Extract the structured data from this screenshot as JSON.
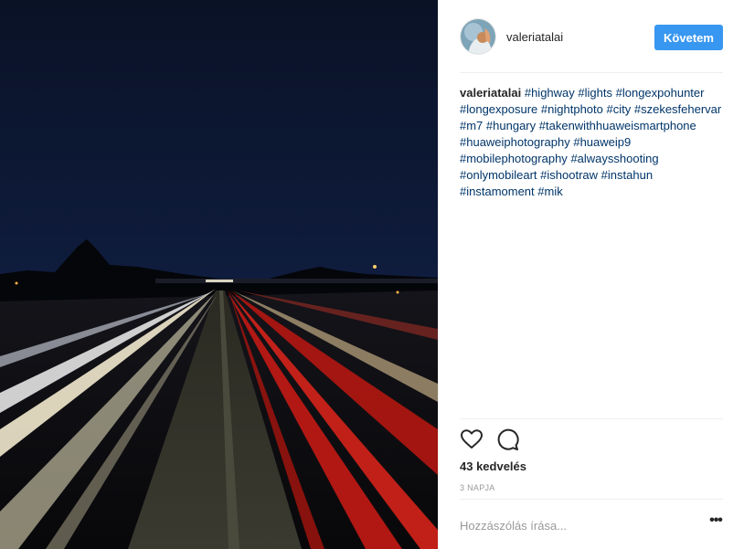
{
  "post": {
    "image_alt": "Highway light trails at night",
    "author": {
      "username": "valeriatalai"
    },
    "follow_button": {
      "label": "Követem"
    },
    "caption": {
      "username": "valeriatalai",
      "hashtags": [
        "#highway",
        "#lights",
        "#longexpohunter",
        "#longexposure",
        "#nightphoto",
        "#city",
        "#szekesfehervar",
        "#m7",
        "#hungary",
        "#takenwithhuaweismartphone",
        "#huaweiphotography",
        "#huaweip9",
        "#mobilephotography",
        "#alwaysshooting",
        "#onlymobileart",
        "#ishootraw",
        "#instahun",
        "#instamoment",
        "#mik"
      ]
    },
    "actions": {
      "like_icon": "heart-icon",
      "comment_icon": "comment-icon"
    },
    "likes_text": "43 kedvelés",
    "time_text": "3 NAPJA",
    "comment": {
      "placeholder": "Hozzászólás írása...",
      "value": ""
    },
    "more_icon": "more-options-icon",
    "colors": {
      "accent": "#3897f0",
      "hashtag": "#003569",
      "muted": "#999999"
    }
  }
}
